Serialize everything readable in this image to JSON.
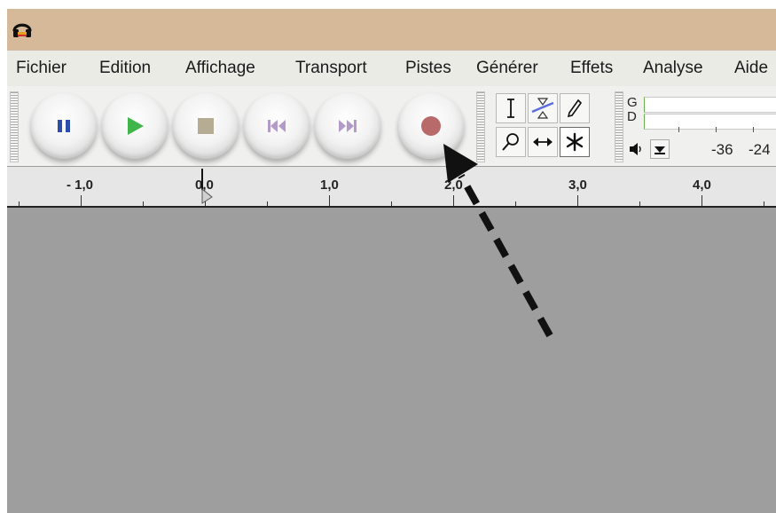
{
  "app": {
    "icon": "headphones-icon"
  },
  "menu": {
    "items": [
      {
        "label": "Fichier"
      },
      {
        "label": "Edition"
      },
      {
        "label": "Affichage"
      },
      {
        "label": "Transport"
      },
      {
        "label": "Pistes"
      },
      {
        "label": "Générer"
      },
      {
        "label": "Effets"
      },
      {
        "label": "Analyse"
      },
      {
        "label": "Aide"
      }
    ]
  },
  "transport": {
    "buttons": [
      {
        "icon": "pause-icon",
        "color": "#2b4fa8"
      },
      {
        "icon": "play-icon",
        "color": "#3fb54a"
      },
      {
        "icon": "stop-icon",
        "color": "#b6ac93"
      },
      {
        "icon": "skip-to-start-icon",
        "color": "#b49ac8"
      },
      {
        "icon": "skip-to-end-icon",
        "color": "#b49ac8"
      },
      {
        "icon": "record-icon",
        "color": "#b86a6a"
      }
    ]
  },
  "tools": {
    "items": [
      {
        "icon": "selection-tool-icon"
      },
      {
        "icon": "envelope-tool-icon"
      },
      {
        "icon": "draw-tool-icon"
      },
      {
        "icon": "zoom-tool-icon"
      },
      {
        "icon": "time-shift-tool-icon"
      },
      {
        "icon": "multi-tool-icon",
        "active": true
      }
    ]
  },
  "meter": {
    "left_label": "G",
    "right_label": "D",
    "volume_icon": "speaker-icon",
    "scale": [
      "-36",
      "-24"
    ]
  },
  "ruler": {
    "labels": [
      "- 1,0",
      "0,0",
      "1,0",
      "2,0",
      "3,0",
      "4,0"
    ]
  },
  "overlay": {
    "arrow_color": "#111111"
  }
}
